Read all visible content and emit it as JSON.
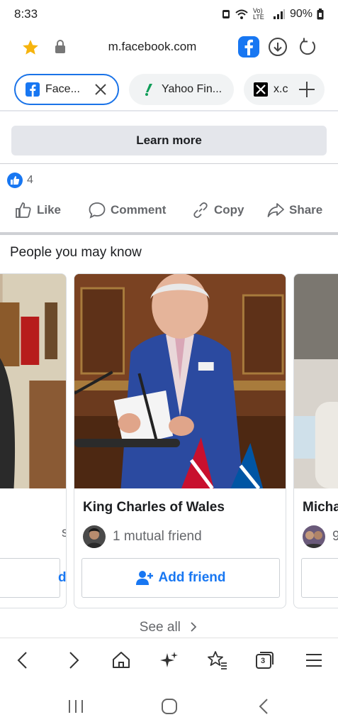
{
  "status_bar": {
    "time": "8:33",
    "network": "Vo) LTE",
    "battery": "90%"
  },
  "browser": {
    "url": "m.facebook.com",
    "tabs": [
      {
        "label": "Face...",
        "active": true,
        "icon": "facebook-icon"
      },
      {
        "label": "Yahoo Fin...",
        "active": false,
        "icon": "yahoo-icon"
      },
      {
        "label": "x.c",
        "active": false,
        "icon": "x-icon"
      }
    ],
    "tabs_count": "3"
  },
  "post": {
    "learn_more_label": "Learn more",
    "reaction_count": "4",
    "actions": {
      "like": "Like",
      "comment": "Comment",
      "copy": "Copy",
      "share": "Share"
    }
  },
  "pymk": {
    "title": "People you may know",
    "cards": [
      {
        "name": "",
        "mutual": "s",
        "button": "d"
      },
      {
        "name": "King Charles of Wales",
        "mutual": "1 mutual friend",
        "button": "Add friend"
      },
      {
        "name": "Micha",
        "mutual": "9",
        "button": ""
      }
    ],
    "see_all": "See all"
  },
  "colors": {
    "facebook_blue": "#1877f2",
    "active_tab_border": "#1a73e8",
    "muted_text": "#65676b",
    "button_gray": "#e4e6eb"
  }
}
